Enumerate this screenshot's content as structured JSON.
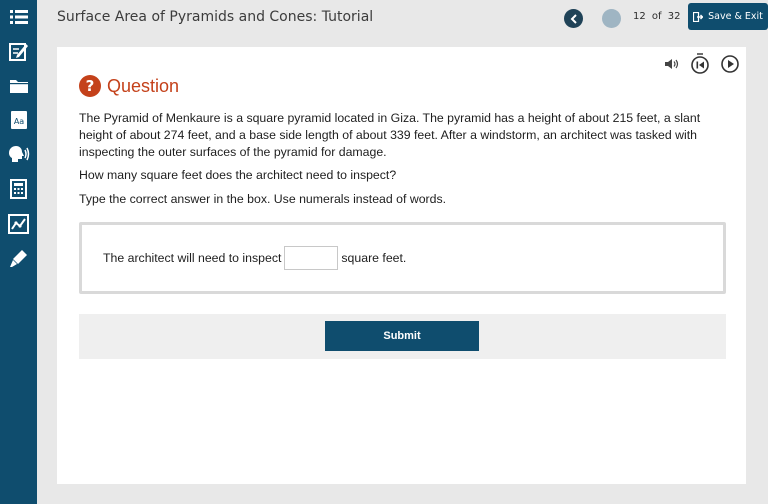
{
  "app": {
    "title": "Surface Area of Pyramids and Cones: Tutorial"
  },
  "navigation": {
    "current_page": "12",
    "of_label": "of",
    "total_pages": "32",
    "save_exit_label": "Save & Exit"
  },
  "sidebar": {
    "items": [
      {
        "icon": "menu-list-icon"
      },
      {
        "icon": "notepad-edit-icon"
      },
      {
        "icon": "folder-icon"
      },
      {
        "icon": "dictionary-icon"
      },
      {
        "icon": "text-to-speech-icon"
      },
      {
        "icon": "calculator-icon"
      },
      {
        "icon": "graph-icon"
      },
      {
        "icon": "highlighter-icon"
      }
    ]
  },
  "question": {
    "heading": "Question",
    "icon_glyph": "?",
    "paragraph1": "The Pyramid of Menkaure is a square pyramid located in Giza. The pyramid has a height of about 215 feet, a slant height of about 274 feet, and a base side length of about 339 feet. After a windstorm, an architect was tasked with inspecting the outer surfaces of the pyramid for damage.",
    "paragraph2": "How many square feet does the architect need to inspect?",
    "paragraph3": "Type the correct answer in the box. Use numerals instead of words.",
    "answer_prefix": "The architect will need to inspect",
    "answer_suffix": "square feet.",
    "answer_value": "",
    "submit_label": "Submit"
  },
  "colors": {
    "sidebar": "#0f4d6e",
    "accent": "#c4411a",
    "button": "#0f4d6e",
    "page_background": "#e8e8e8"
  }
}
